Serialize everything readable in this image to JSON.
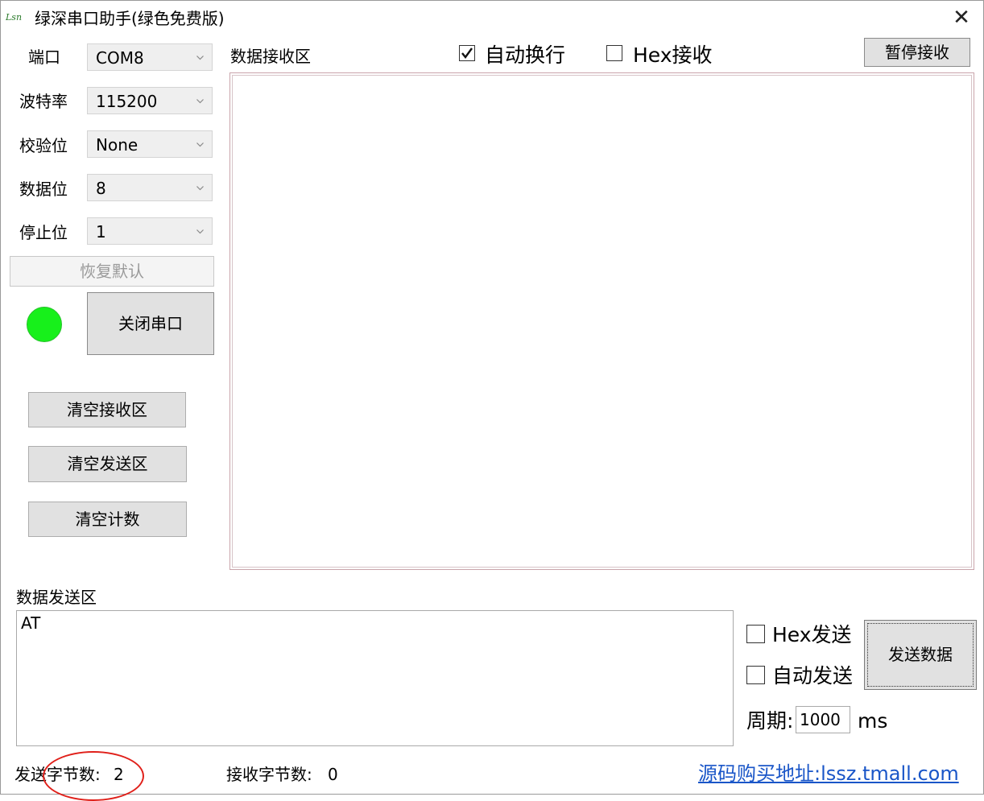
{
  "window": {
    "title": "绿深串口助手(绿色免费版)",
    "icon_text": "Lsn",
    "close_glyph": "✕"
  },
  "settings": {
    "port_label": "端口",
    "port_value": "COM8",
    "baud_label": "波特率",
    "baud_value": "115200",
    "parity_label": "校验位",
    "parity_value": "None",
    "databits_label": "数据位",
    "databits_value": "8",
    "stopbits_label": "停止位",
    "stopbits_value": "1",
    "restore_defaults_label": "恢复默认"
  },
  "connection": {
    "status_color": "#17f01b",
    "toggle_label": "关闭串口"
  },
  "actions": {
    "clear_rx_label": "清空接收区",
    "clear_tx_label": "清空发送区",
    "clear_count_label": "清空计数"
  },
  "receive": {
    "title": "数据接收区",
    "auto_wrap_label": "自动换行",
    "auto_wrap_checked": true,
    "hex_rx_label": "Hex接收",
    "hex_rx_checked": false,
    "pause_label": "暂停接收",
    "content": ""
  },
  "send": {
    "title": "数据发送区",
    "content": "AT",
    "hex_tx_label": "Hex发送",
    "hex_tx_checked": false,
    "auto_send_label": "自动发送",
    "auto_send_checked": false,
    "send_button_label": "发送数据",
    "period_label": "周期:",
    "period_value": "1000",
    "period_unit": "ms"
  },
  "status": {
    "tx_bytes_label": "发送字节数:",
    "tx_bytes_value": "2",
    "rx_bytes_label": "接收字节数:",
    "rx_bytes_value": "0",
    "link_text": "源码购买地址:lssz.tmall.com"
  },
  "colors": {
    "accent_link": "#1a56c8",
    "annotation": "#e0201a"
  }
}
